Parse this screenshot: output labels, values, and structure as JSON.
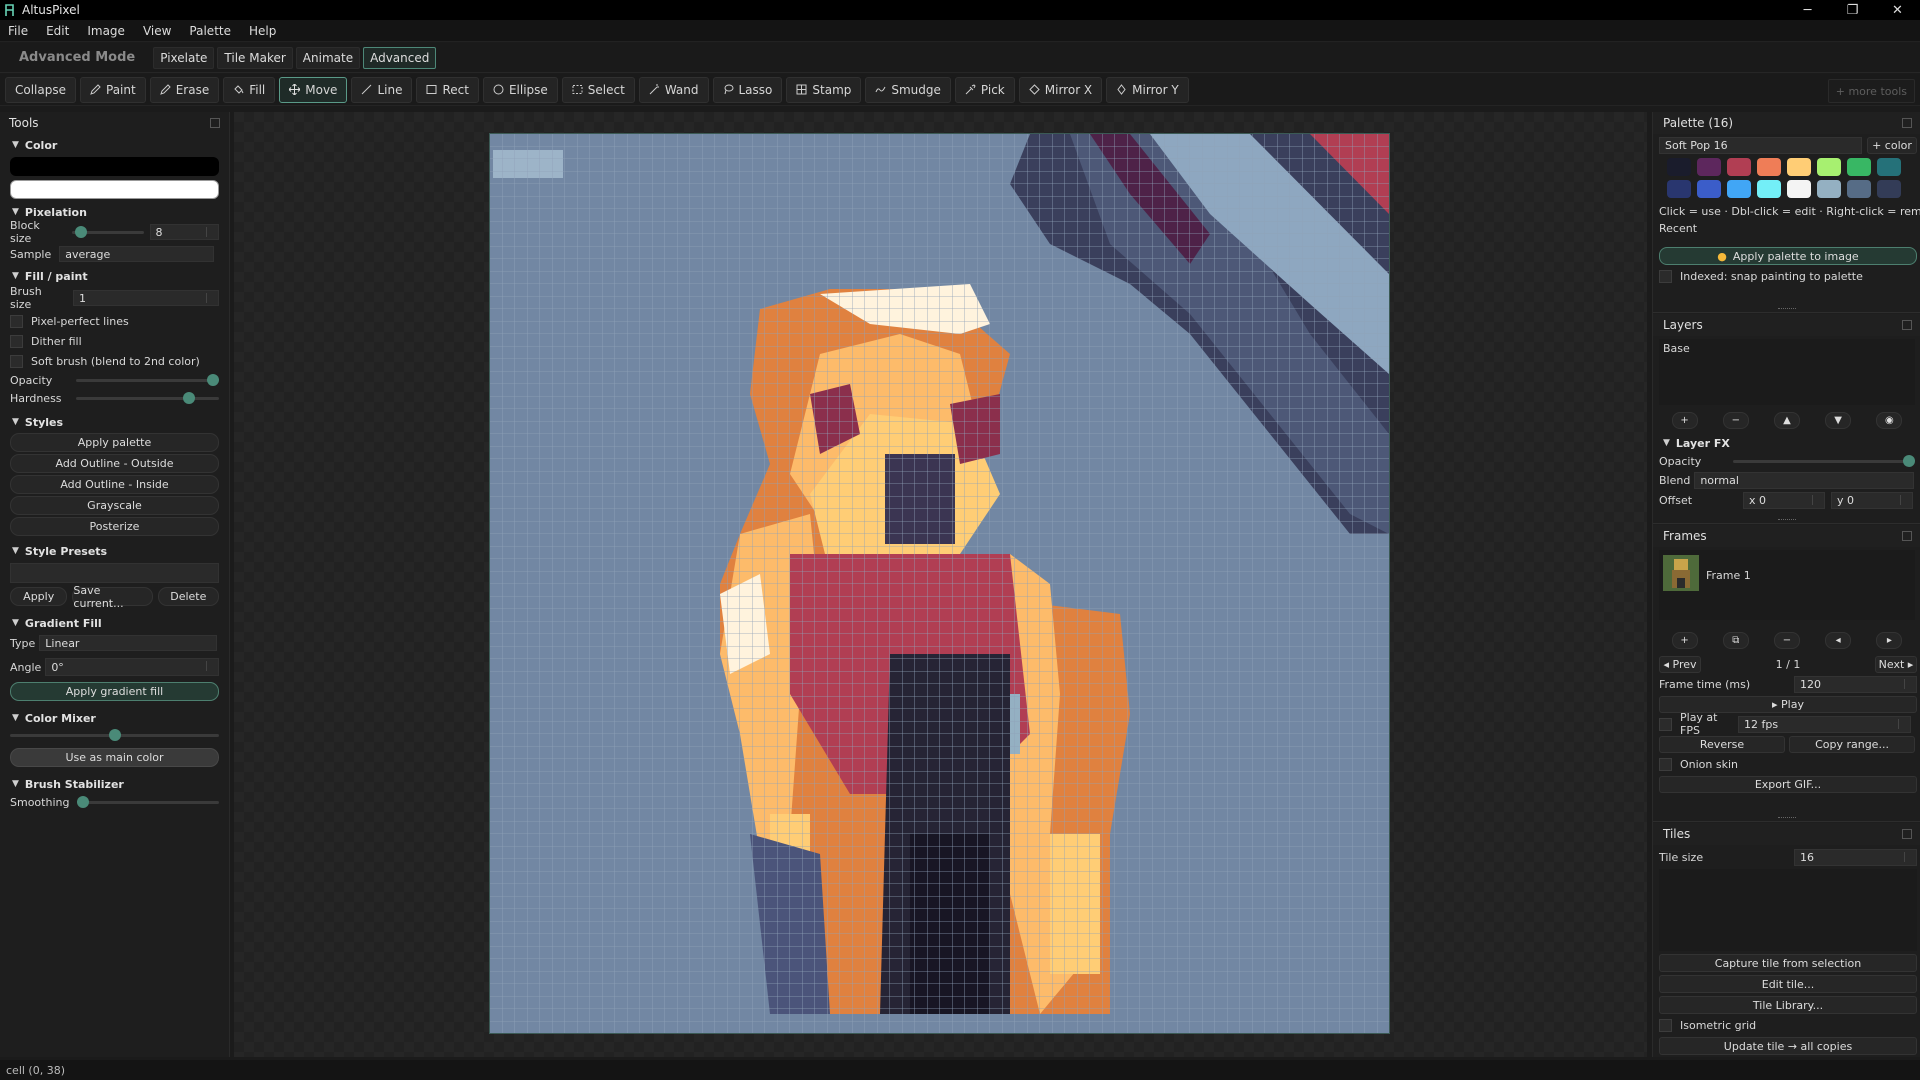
{
  "app": {
    "title": "AltusPixel"
  },
  "window_controls": {
    "minimize": "─",
    "restore": "❐",
    "close": "✕"
  },
  "menu": [
    "File",
    "Edit",
    "Image",
    "View",
    "Palette",
    "Help"
  ],
  "mode": {
    "label": "Advanced Mode",
    "tabs": [
      "Pixelate",
      "Tile Maker",
      "Animate",
      "Advanced"
    ],
    "active": "Advanced"
  },
  "toolbar": {
    "collapse": "Collapse",
    "tools": [
      {
        "label": "Paint",
        "icon": "pencil-icon"
      },
      {
        "label": "Erase",
        "icon": "eraser-icon"
      },
      {
        "label": "Fill",
        "icon": "bucket-icon"
      },
      {
        "label": "Move",
        "icon": "move-icon",
        "active": true
      },
      {
        "label": "Line",
        "icon": "line-icon"
      },
      {
        "label": "Rect",
        "icon": "rect-icon"
      },
      {
        "label": "Ellipse",
        "icon": "ellipse-icon"
      },
      {
        "label": "Select",
        "icon": "select-icon"
      },
      {
        "label": "Wand",
        "icon": "wand-icon"
      },
      {
        "label": "Lasso",
        "icon": "lasso-icon"
      },
      {
        "label": "Stamp",
        "icon": "stamp-icon"
      },
      {
        "label": "Smudge",
        "icon": "smudge-icon"
      },
      {
        "label": "Pick",
        "icon": "eyedropper-icon"
      },
      {
        "label": "Mirror X",
        "icon": "mirror-x-icon"
      },
      {
        "label": "Mirror Y",
        "icon": "mirror-y-icon"
      }
    ],
    "more_tools": "+ more tools"
  },
  "tools_panel": {
    "title": "Tools",
    "color": {
      "title": "Color",
      "primary": "#000000",
      "secondary": "#ffffff"
    },
    "pixelation": {
      "title": "Pixelation",
      "block_size_label": "Block size",
      "block_size": "8",
      "block_size_fraction": 0.05,
      "sample_label": "Sample",
      "sample": "average"
    },
    "fill_paint": {
      "title": "Fill / paint",
      "brush_size_label": "Brush size",
      "brush_size": "1",
      "pixel_perfect": "Pixel-perfect lines",
      "dither": "Dither fill",
      "soft_brush": "Soft brush (blend to 2nd color)",
      "opacity_label": "Opacity",
      "opacity_fraction": 1.0,
      "hardness_label": "Hardness",
      "hardness_fraction": 0.82
    },
    "styles": {
      "title": "Styles",
      "buttons": [
        "Apply palette",
        "Add Outline - Outside",
        "Add Outline - Inside",
        "Grayscale",
        "Posterize"
      ]
    },
    "style_presets": {
      "title": "Style Presets",
      "apply": "Apply",
      "save": "Save current...",
      "delete": "Delete"
    },
    "gradient": {
      "title": "Gradient Fill",
      "type_label": "Type",
      "type": "Linear",
      "angle_label": "Angle",
      "angle": "0°",
      "apply": "Apply gradient fill"
    },
    "mixer": {
      "title": "Color Mixer",
      "mix_fraction": 0.5,
      "use_main": "Use as main color"
    },
    "stabilizer": {
      "title": "Brush Stabilizer",
      "smoothing_label": "Smoothing",
      "smoothing_fraction": 0.0
    }
  },
  "palette_panel": {
    "title": "Palette (16)",
    "name": "Soft Pop 16",
    "add_color": "+ color",
    "colors": [
      "#1a1c2c",
      "#5d275d",
      "#b13e53",
      "#ef7d57",
      "#ffcd75",
      "#a7f070",
      "#38b764",
      "#257179",
      "#29366f",
      "#3b5dc9",
      "#41a6f6",
      "#73eff7",
      "#f4f4f4",
      "#94b0c2",
      "#566c86",
      "#333c57"
    ],
    "hint": "Click = use · Dbl-click = edit · Right-click = remove",
    "recent": "Recent",
    "apply": "Apply palette to image",
    "indexed": "Indexed: snap painting to palette"
  },
  "layers_panel": {
    "title": "Layers",
    "layers": [
      "Base"
    ],
    "fx_title": "Layer FX",
    "opacity_label": "Opacity",
    "opacity_fraction": 1.0,
    "blend_label": "Blend",
    "blend": "normal",
    "offset_label": "Offset",
    "offset_x": "x 0",
    "offset_y": "y 0"
  },
  "frames_panel": {
    "title": "Frames",
    "frame_name": "Frame 1",
    "prev": "◂ Prev",
    "next": "Next ▸",
    "counter": "1 / 1",
    "frame_time_label": "Frame time (ms)",
    "frame_time": "120",
    "play": "▸ Play",
    "fps_label": "Play at FPS",
    "fps": "12 fps",
    "reverse": "Reverse",
    "copy_range": "Copy range...",
    "onion": "Onion skin",
    "export_gif": "Export GIF..."
  },
  "tiles_panel": {
    "title": "Tiles",
    "tile_size_label": "Tile size",
    "tile_size": "16",
    "capture": "Capture tile from selection",
    "edit": "Edit tile...",
    "library": "Tile Library...",
    "isometric": "Isometric grid",
    "update": "Update tile → all copies"
  },
  "status": {
    "text": "cell (0, 38)"
  }
}
